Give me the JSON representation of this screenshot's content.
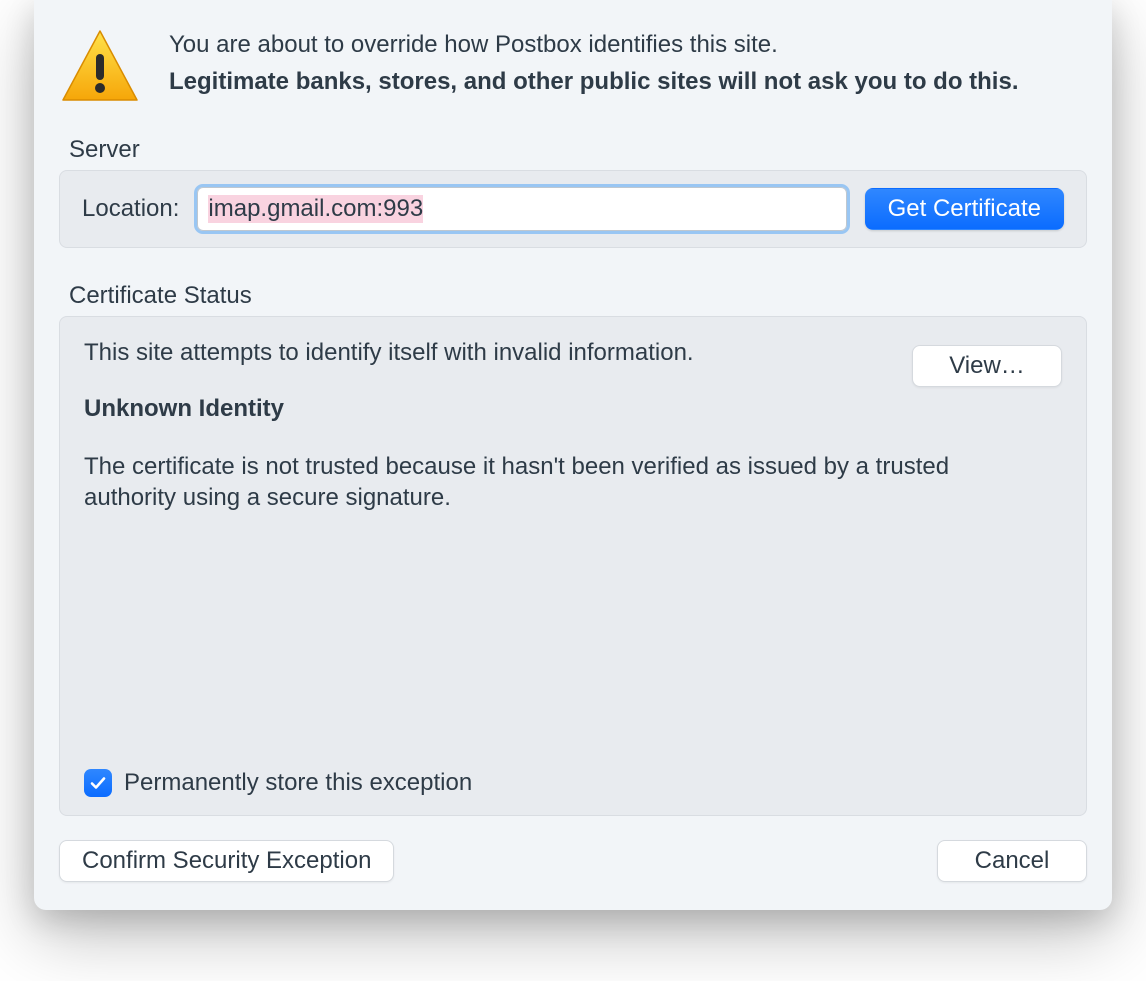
{
  "header": {
    "line1": "You are about to override how Postbox identifies this site.",
    "line2": "Legitimate banks, stores, and other public sites will not ask you to do this."
  },
  "server": {
    "title": "Server",
    "location_label": "Location:",
    "location_value": "imap.gmail.com:993",
    "get_cert_label": "Get Certificate"
  },
  "status": {
    "title": "Certificate Status",
    "intro": "This site attempts to identify itself with invalid information.",
    "view_label": "View…",
    "heading": "Unknown Identity",
    "description": "The certificate is not trusted because it hasn't been verified as issued by a trusted authority using a secure signature.",
    "checkbox_label": "Permanently store this exception",
    "checkbox_checked": true
  },
  "footer": {
    "confirm_label": "Confirm Security Exception",
    "cancel_label": "Cancel"
  }
}
